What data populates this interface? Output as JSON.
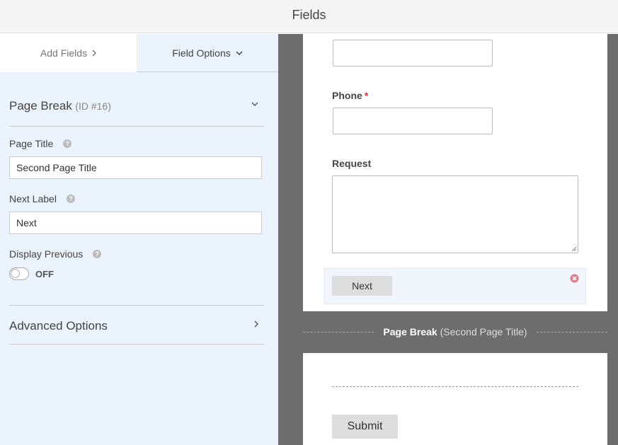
{
  "header": {
    "title": "Fields"
  },
  "tabs": {
    "add_fields": "Add Fields",
    "field_options": "Field Options"
  },
  "options": {
    "section_name": "Page Break",
    "section_id": "(ID #16)",
    "page_title_label": "Page Title",
    "page_title_value": "Second Page Title",
    "next_label_label": "Next Label",
    "next_label_value": "Next",
    "display_previous_label": "Display Previous",
    "display_previous_state": "OFF",
    "advanced_options": "Advanced Options"
  },
  "preview": {
    "phone_label": "Phone",
    "required_mark": "*",
    "request_label": "Request",
    "next_button": "Next",
    "page_break_label": "Page Break",
    "page_break_title": "(Second Page Title)",
    "submit_button": "Submit"
  },
  "icons": {
    "tab_add_chevron": "chevron-right-icon",
    "tab_options_chevron": "chevron-down-icon",
    "section_chevron": "chevron-down-icon",
    "help": "question-circle-icon",
    "advanced_chevron": "chevron-right-icon",
    "delete": "close-circle-icon",
    "resize": "resize-grip-icon"
  },
  "colors": {
    "panel_bg": "#ebf3fc",
    "canvas_bg": "#6d6d6d",
    "required": "#d63638",
    "delete_icon": "#d9828b"
  }
}
